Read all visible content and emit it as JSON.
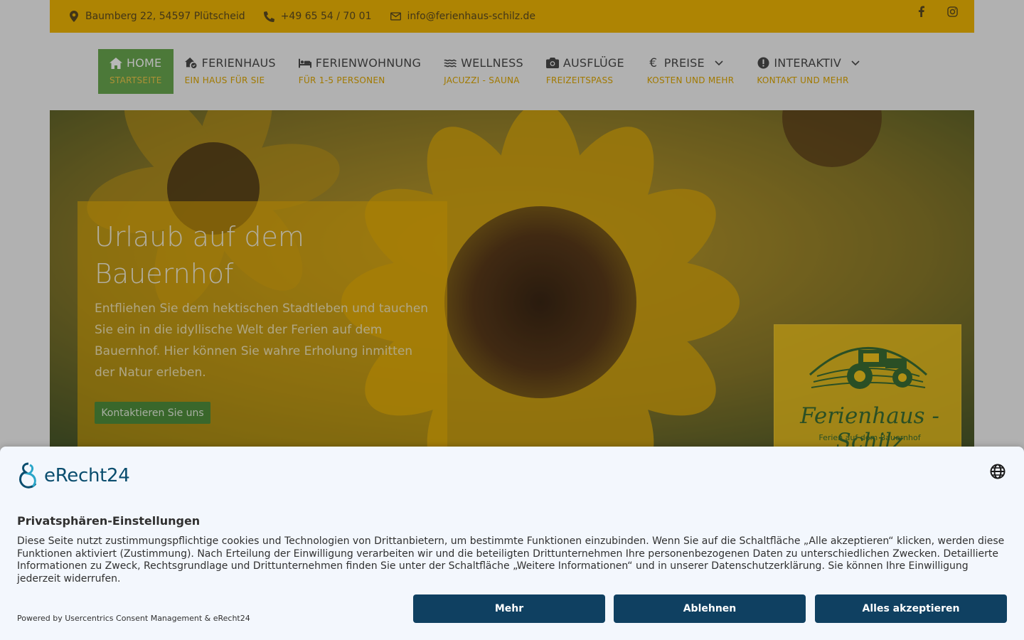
{
  "topbar": {
    "address": "Baumberg 22, 54597 Plütscheid",
    "phone": "+49 65 54 / 70 01",
    "email": "info@ferienhaus-schilz.de",
    "social": [
      "facebook-icon",
      "instagram-icon"
    ]
  },
  "nav": {
    "items": [
      {
        "label": "HOME",
        "sub": "STARTSEITE",
        "icon": "home-icon",
        "active": true
      },
      {
        "label": "FERIENHAUS",
        "sub": "EIN HAUS FÜR SIE",
        "icon": "house-check-icon"
      },
      {
        "label": "FERIENWOHNUNG",
        "sub": "FÜR 1-5 PERSONEN",
        "icon": "bed-icon"
      },
      {
        "label": "WELLNESS",
        "sub": "JACUZZI - SAUNA",
        "icon": "waves-icon"
      },
      {
        "label": "AUSFLÜGE",
        "sub": "FREIZEITSPASS",
        "icon": "camera-icon"
      },
      {
        "label": "PREISE",
        "sub": "KOSTEN UND MEHR",
        "icon": "euro-icon",
        "dropdown": true
      },
      {
        "label": "INTERAKTIV",
        "sub": "KONTAKT UND MEHR",
        "icon": "alert-circle-icon",
        "dropdown": true
      }
    ]
  },
  "hero": {
    "title": "Urlaub auf dem Bauernhof",
    "text": "Entfliehen Sie dem hektischen Stadtleben und tauchen Sie ein in die idyllische Welt der Ferien auf dem Bauernhof. Hier können Sie wahre Erholung inmitten der Natur erleben.",
    "cta": "Kontaktieren Sie uns",
    "logo_title": "Ferienhaus - Schilz",
    "logo_sub": "Ferien auf dem Bauernhof"
  },
  "consent": {
    "brand": "eRecht24",
    "title": "Privatsphären-Einstellungen",
    "description": "Diese Seite nutzt zustimmungspflichtige cookies und Technologien von Drittanbietern, um bestimmte Funktionen einzubinden. Wenn Sie auf die Schaltfläche „Alle akzeptieren“ klicken, werden diese Funktionen aktiviert (Zustimmung). Nach Erteilung der Einwilligung verarbeiten wir und die beteiligten Drittunternehmen Ihre personenbezogenen Daten zu unterschiedlichen Zwecken. Detaillierte Informationen zu Zweck, Rechtsgrundlage und Drittunternehmen finden Sie unter der Schaltfläche „Weitere Informationen“ und in unserer Datenschutzerklärung. Sie können Ihre Einwilligung jederzeit widerrufen.",
    "powered": "Powered by Usercentrics Consent Management & eRecht24",
    "btn_more": "Mehr",
    "btn_decline": "Ablehnen",
    "btn_accept": "Alles akzeptieren"
  },
  "colors": {
    "accent_yellow": "#f2b705",
    "nav_active_green": "#6aa84f",
    "consent_button": "#0f4061"
  }
}
